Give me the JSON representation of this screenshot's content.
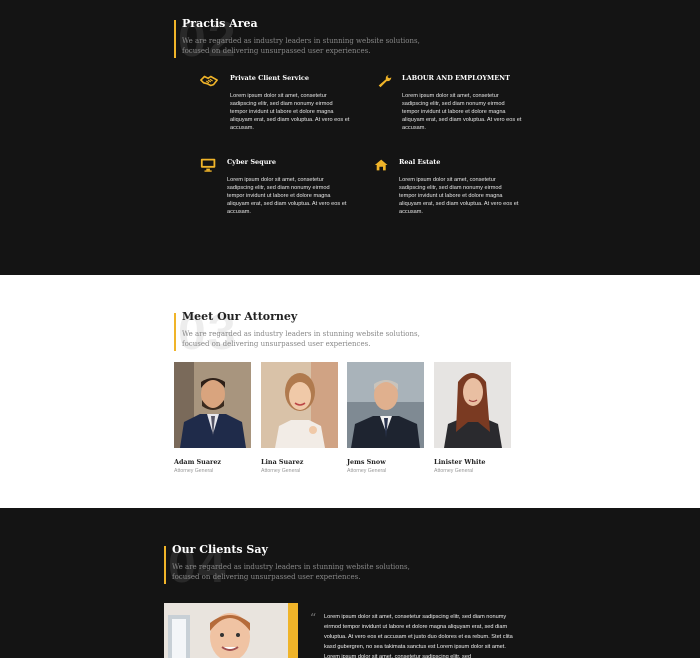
{
  "practice": {
    "number": "02",
    "title": "Practis Area",
    "subtitle_line1": "We are regarded as industry leaders in stunning website solutions,",
    "subtitle_line2": "focused on delivering unsurpassed user experiences.",
    "services": [
      {
        "icon": "handshake-icon",
        "title": "Private Client Service",
        "text": "Lorem ipsum dolor sit amet, consetetur sadipscing elitr, sed diam nonumy eirmod tempor invidunt ut labore et dolore magna aliquyam erat, sed diam voluptua. At vero eos et accusam."
      },
      {
        "icon": "wrench-icon",
        "title": "LABOUR AND EMPLOYMENT",
        "text": "Lorem ipsum dolor sit amet, consetetur sadipscing elitr, sed diam nonumy eirmod tempor invidunt ut labore et dolore magna aliquyam erat, sed diam voluptua. At vero eos et accusam."
      },
      {
        "icon": "monitor-icon",
        "title": "Cyber Sequre",
        "text": "Lorem ipsum dolor sit amet, consetetur sadipscing elitr, sed diam nonumy eirmod tempor invidunt ut labore et dolore magna aliquyam erat, sed diam voluptua. At vero eos et accusam."
      },
      {
        "icon": "home-icon",
        "title": "Real Estate",
        "text": "Lorem ipsum dolor sit amet, consetetur sadipscing elitr, sed diam nonumy eirmod tempor invidunt ut labore et dolore magna aliquyam erat, sed diam voluptua. At vero eos et accusam."
      }
    ]
  },
  "attorneys": {
    "number": "03",
    "title": "Meet Our Attorney",
    "subtitle_line1": "We are regarded as industry leaders in stunning website solutions,",
    "subtitle_line2": "focused on delivering unsurpassed user experiences.",
    "people": [
      {
        "name": "Adam Suarez",
        "role": "Attorney General"
      },
      {
        "name": "Lina Suarez",
        "role": "Attorney General"
      },
      {
        "name": "Jems Snow",
        "role": "Attorney General"
      },
      {
        "name": "Linister White",
        "role": "Attorney General"
      }
    ]
  },
  "clients": {
    "number": "04",
    "title": "Our Clients Say",
    "subtitle_line1": "We are regarded as industry leaders in stunning website solutions,",
    "subtitle_line2": "focused on delivering unsurpassed user experiences.",
    "quote_mark": "“",
    "quote": "Lorem ipsum dolor sit amet, consetetur sadipscing elitr, sed diam nonumy eirmod tempor invidunt ut labore et dolore magna aliquyam erat, sed diam voluptua. At vero eos et accusam et justo duo dolores et ea rebum. Stet clita kasd gubergren, no sea takimata sanctus est Lorem ipsum dolor sit amet. Lorem ipsum dolor sit amet, consetetur sadipscing elitr, sed"
  },
  "colors": {
    "accent": "#f0b429",
    "dark_bg": "#141414",
    "light_bg": "#ffffff"
  }
}
